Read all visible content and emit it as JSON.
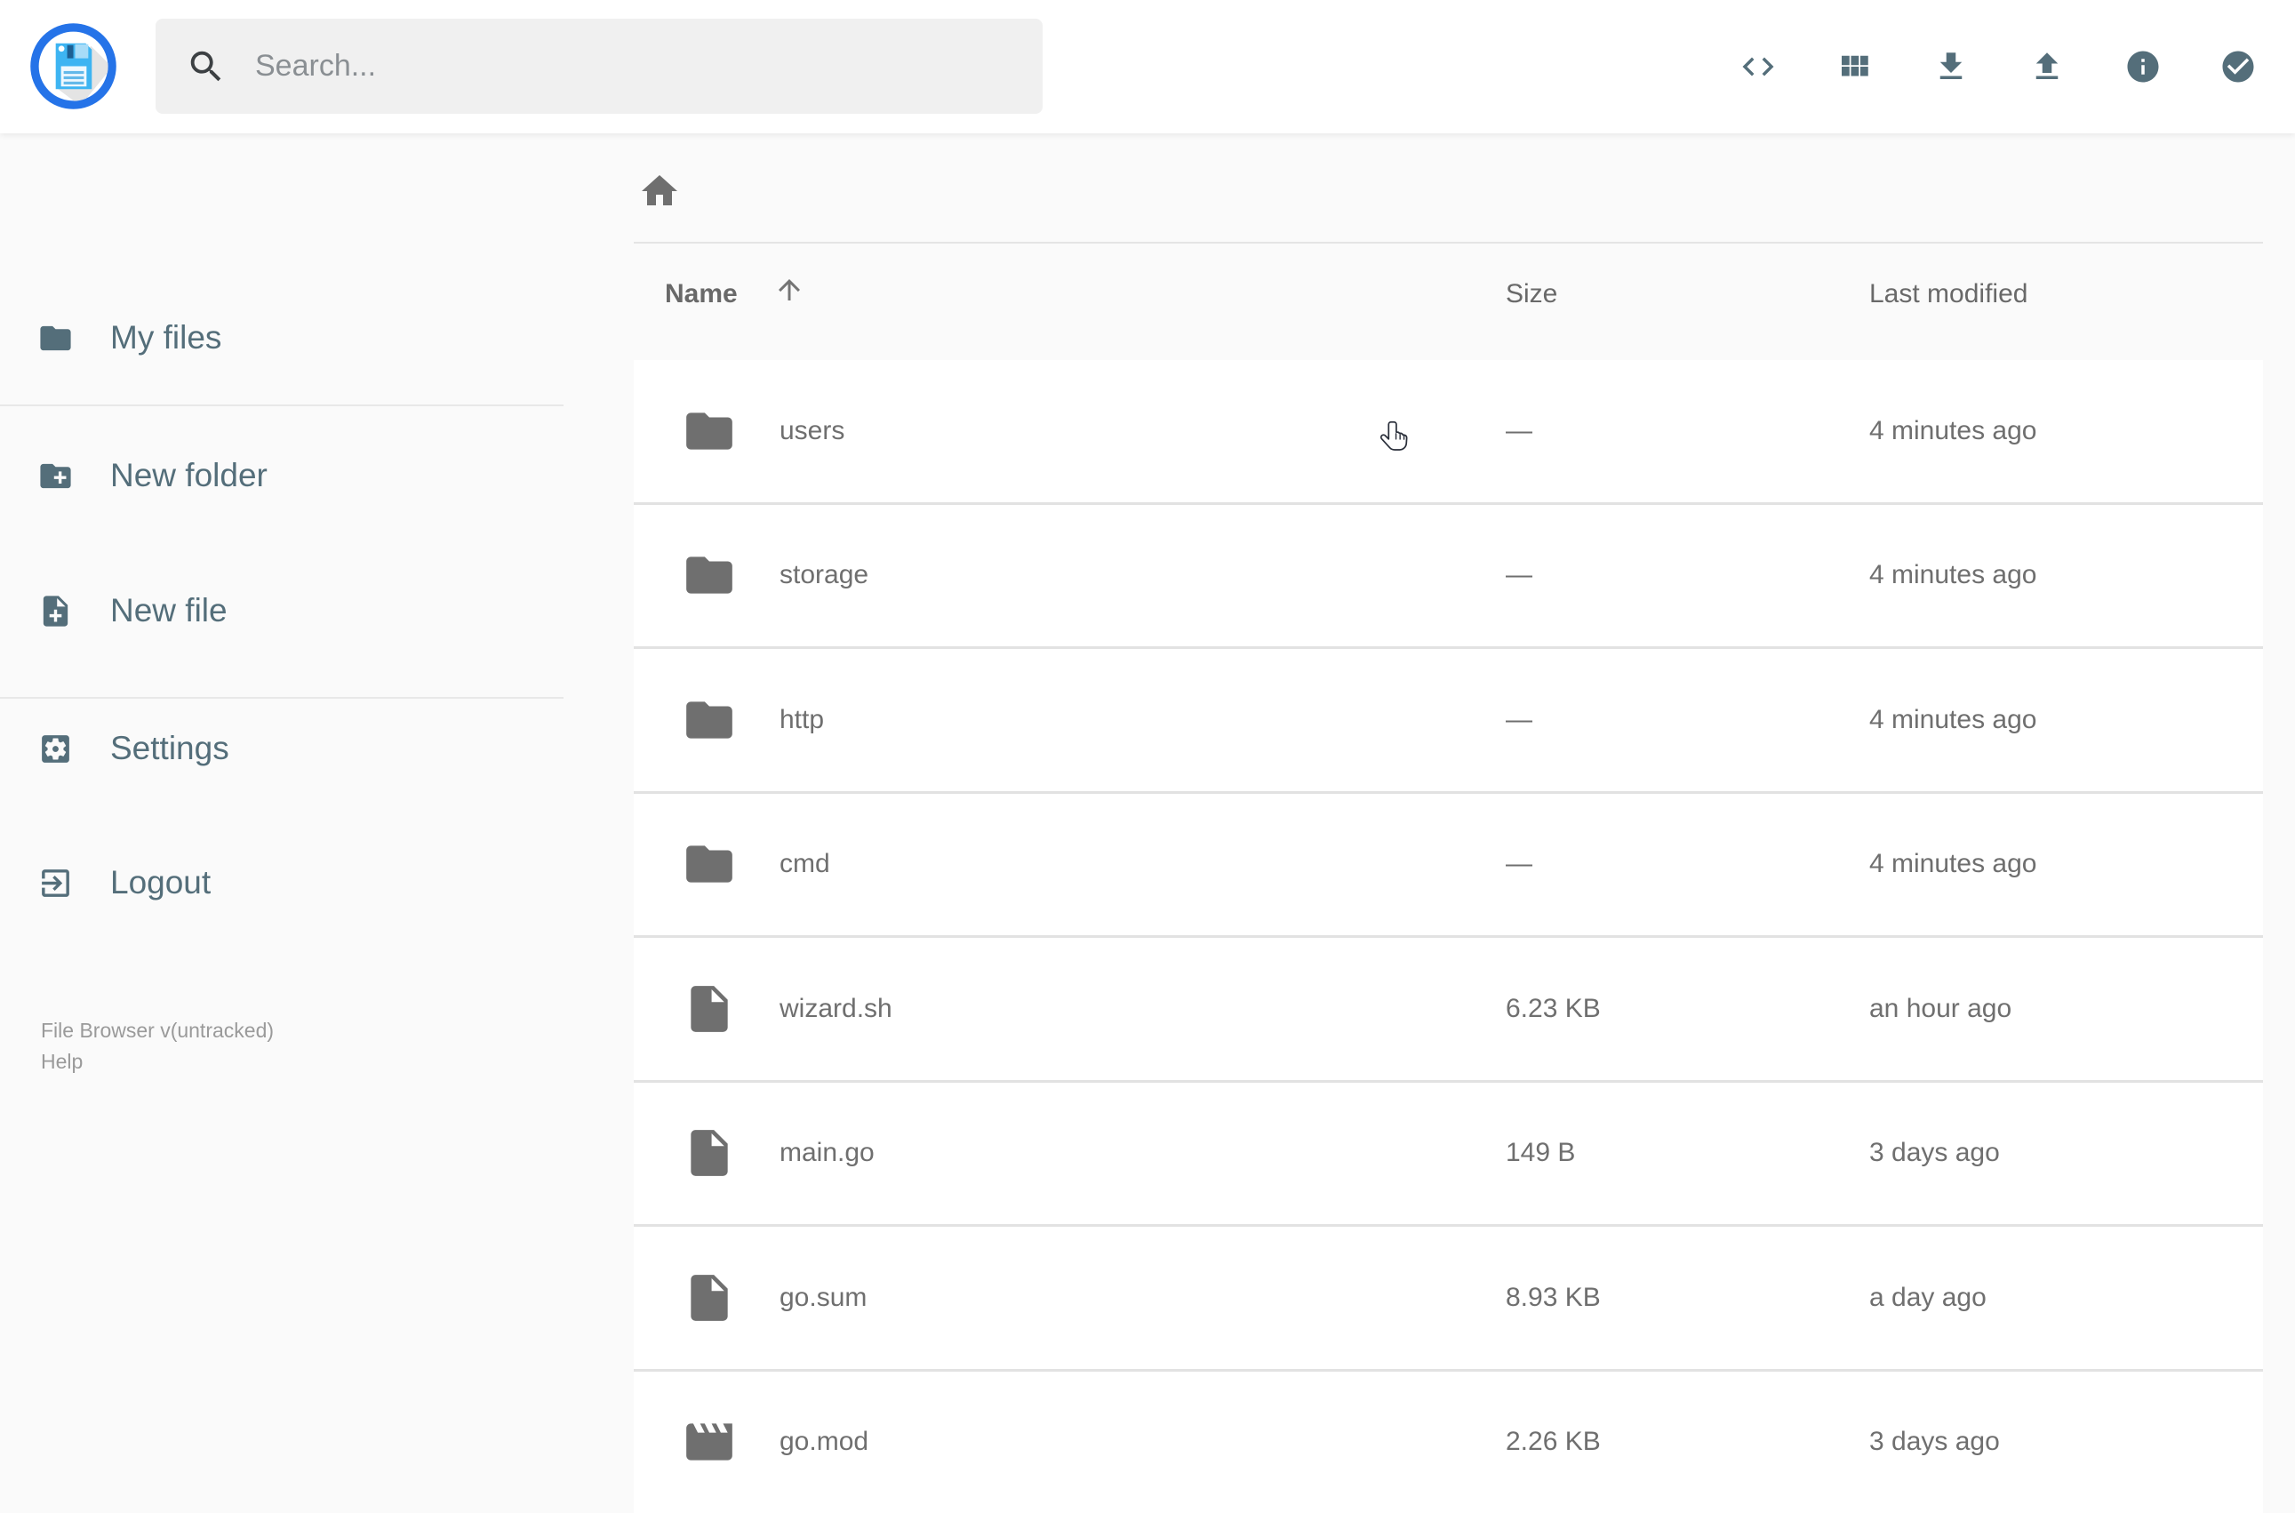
{
  "header": {
    "search_placeholder": "Search...",
    "actions": [
      {
        "icon": "code-icon"
      },
      {
        "icon": "grid-view-icon"
      },
      {
        "icon": "download-icon"
      },
      {
        "icon": "upload-icon"
      },
      {
        "icon": "info-icon"
      },
      {
        "icon": "check-circle-icon"
      }
    ]
  },
  "sidebar": {
    "items": [
      {
        "label": "My files",
        "icon": "folder-icon"
      },
      {
        "label": "New folder",
        "icon": "new-folder-icon"
      },
      {
        "label": "New file",
        "icon": "new-file-icon"
      },
      {
        "label": "Settings",
        "icon": "settings-icon"
      },
      {
        "label": "Logout",
        "icon": "logout-icon"
      }
    ],
    "footer": {
      "version": "File Browser v(untracked)",
      "help": "Help"
    }
  },
  "listing": {
    "columns": {
      "name": "Name",
      "size": "Size",
      "modified": "Last modified"
    },
    "sort": {
      "column": "name",
      "direction": "ascending"
    },
    "rows": [
      {
        "name": "users",
        "type": "folder",
        "size": "—",
        "modified": "4 minutes ago"
      },
      {
        "name": "storage",
        "type": "folder",
        "size": "—",
        "modified": "4 minutes ago"
      },
      {
        "name": "http",
        "type": "folder",
        "size": "—",
        "modified": "4 minutes ago"
      },
      {
        "name": "cmd",
        "type": "folder",
        "size": "—",
        "modified": "4 minutes ago"
      },
      {
        "name": "wizard.sh",
        "type": "file",
        "size": "6.23 KB",
        "modified": "an hour ago"
      },
      {
        "name": "main.go",
        "type": "file",
        "size": "149 B",
        "modified": "3 days ago"
      },
      {
        "name": "go.sum",
        "type": "file",
        "size": "8.93 KB",
        "modified": "a day ago"
      },
      {
        "name": "go.mod",
        "type": "video",
        "size": "2.26 KB",
        "modified": "3 days ago"
      }
    ]
  },
  "colors": {
    "accent": "#546e7a",
    "item_gray": "#6f6f6f",
    "background": "#fafafa",
    "logo_ring": "#2573e8",
    "logo_disk": "#3db4f2"
  }
}
